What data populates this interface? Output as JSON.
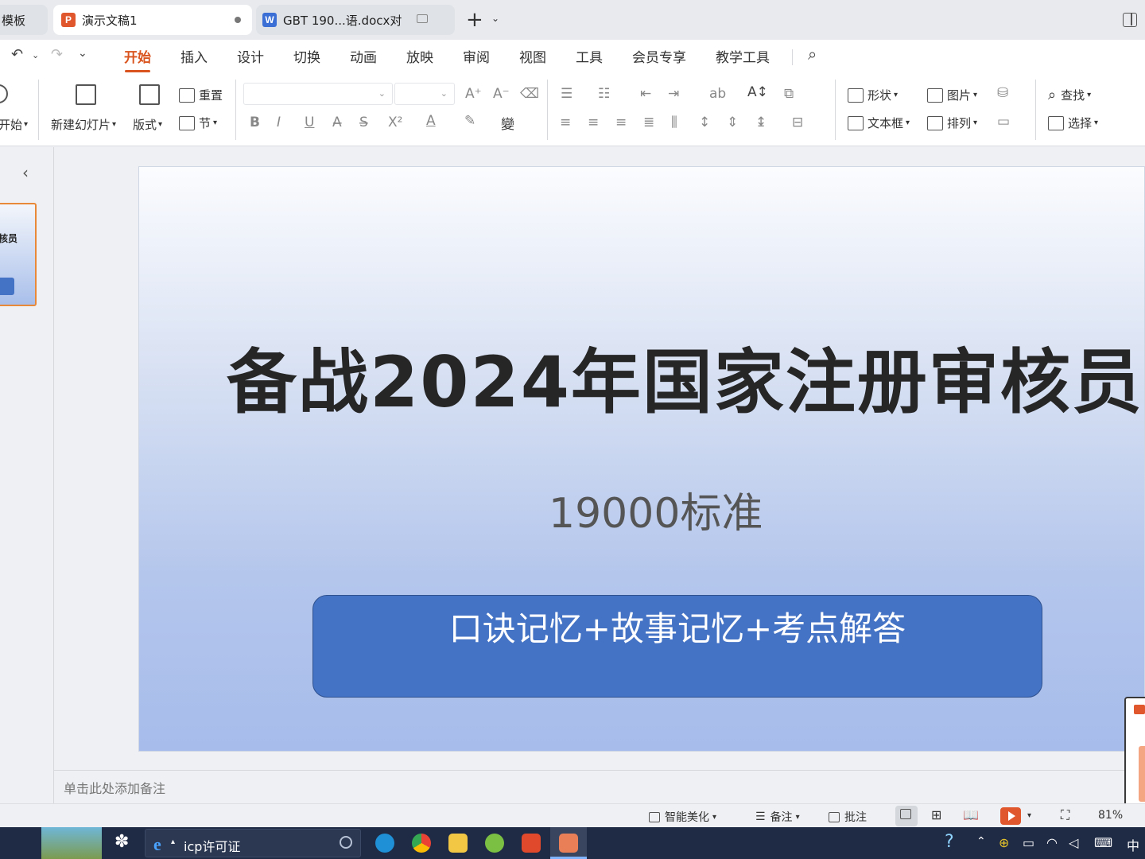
{
  "tabs": [
    {
      "label": "模板"
    },
    {
      "label": "演示文稿1",
      "icon": "P"
    },
    {
      "label": "GBT 190...语.docx对",
      "icon": "W"
    }
  ],
  "menu": [
    "开始",
    "插入",
    "设计",
    "切换",
    "动画",
    "放映",
    "审阅",
    "视图",
    "工具",
    "会员专享",
    "教学工具"
  ],
  "ribbon": {
    "start_label": "开始",
    "new_slide": "新建幻灯片",
    "layout": "版式",
    "reset": "重置",
    "section": "节",
    "shape": "形状",
    "picture": "图片",
    "textbox": "文本框",
    "arrange": "排列",
    "find": "查找",
    "select": "选择"
  },
  "thumbnail": {
    "text": "核员"
  },
  "slide": {
    "title": "备战2024年国家注册审核员",
    "subtitle": "19000标准",
    "box_text": "口诀记忆+故事记忆+考点解答"
  },
  "notes": {
    "placeholder": "单击此处添加备注"
  },
  "statusbar": {
    "beautify": "智能美化",
    "notes": "备注",
    "comment": "批注",
    "zoom": "81%"
  },
  "taskbar": {
    "search_text": "icp许可证",
    "ime": "中"
  },
  "colors": {
    "accent": "#d9541e",
    "slide_box": "#4472c4",
    "ppt_icon": "#e0562d",
    "doc_icon": "#3b6fd6"
  }
}
